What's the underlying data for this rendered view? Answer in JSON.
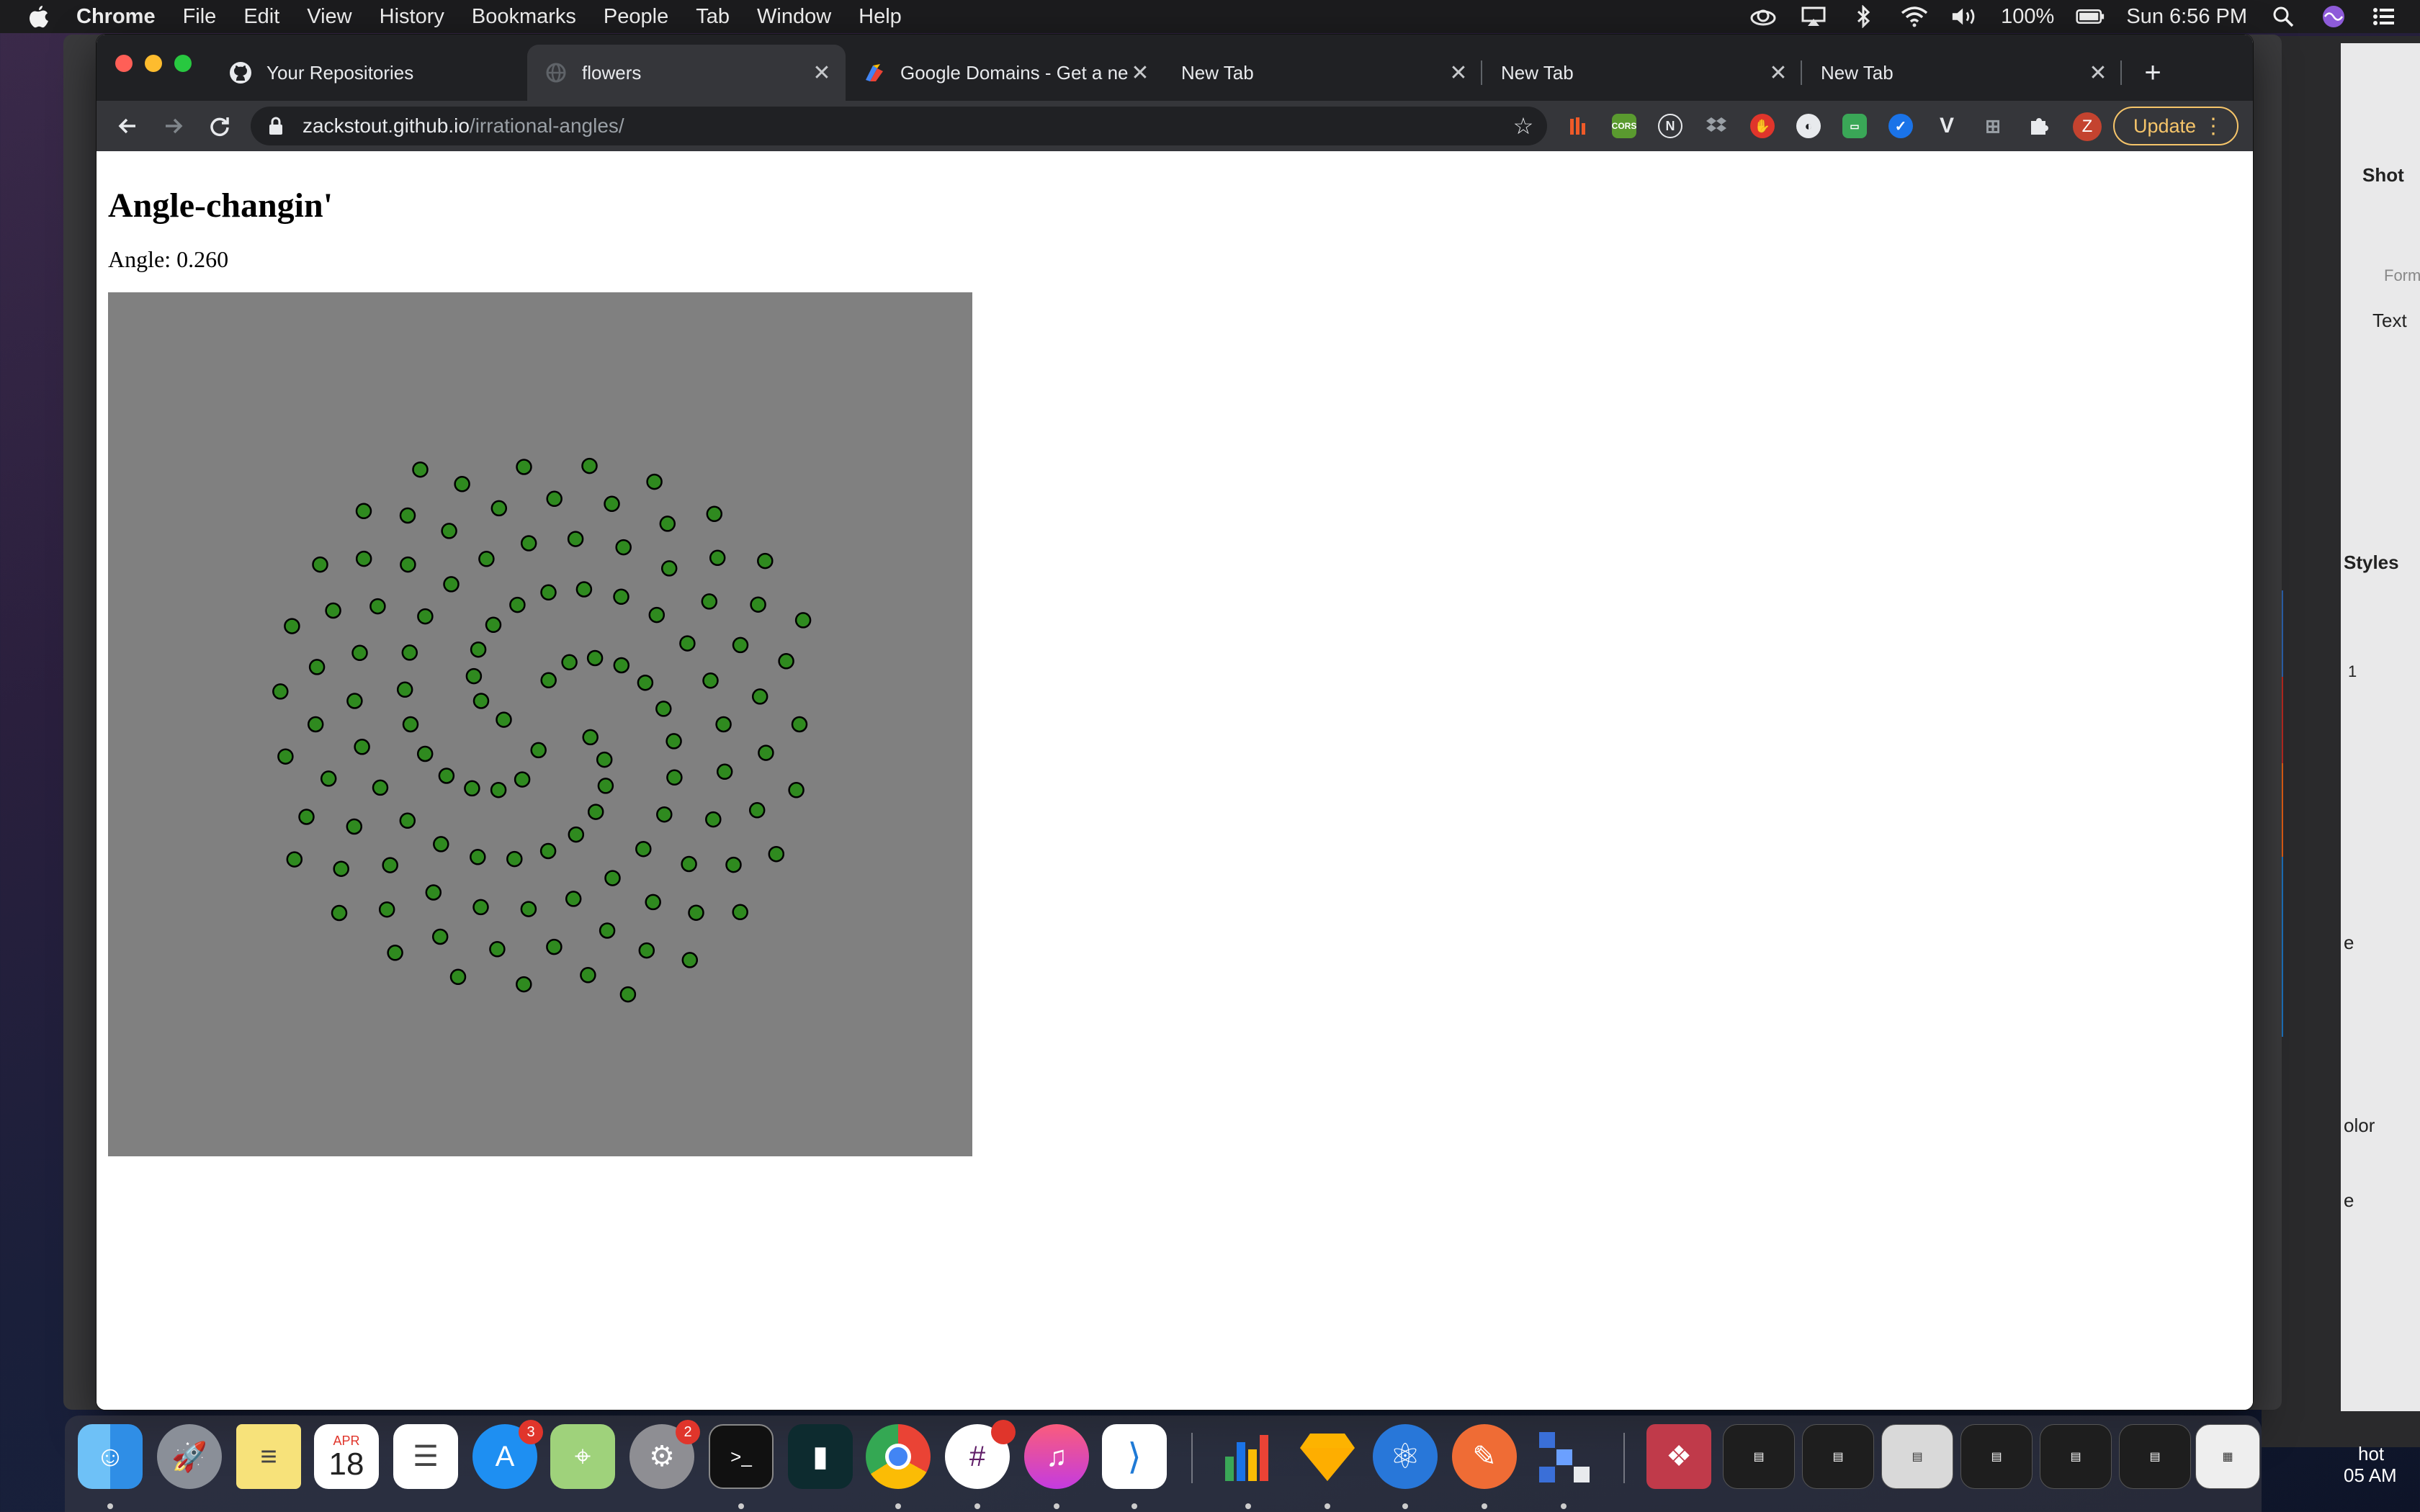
{
  "menubar": {
    "app": "Chrome",
    "items": [
      "File",
      "Edit",
      "View",
      "History",
      "Bookmarks",
      "People",
      "Tab",
      "Window",
      "Help"
    ],
    "battery": "100%",
    "clock": "Sun 6:56 PM"
  },
  "tabs": [
    {
      "title": "Your Repositories",
      "icon": "github-icon",
      "active": false
    },
    {
      "title": "flowers",
      "icon": "globe-icon",
      "active": true
    },
    {
      "title": "Google Domains - Get a new",
      "icon": "google-domains-icon",
      "active": false
    },
    {
      "title": "New Tab",
      "icon": "",
      "active": false
    },
    {
      "title": "New Tab",
      "icon": "",
      "active": false
    },
    {
      "title": "New Tab",
      "icon": "",
      "active": false
    }
  ],
  "address": {
    "host": "zackstout.github.io",
    "path": "/irrational-angles/"
  },
  "profile_initial": "Z",
  "update_label": "Update",
  "page": {
    "title": "Angle-changin'",
    "angle_label": "Angle: 0.260",
    "dot_count": 120,
    "angle_value": 0.26,
    "dot_color": "#2f8a1f",
    "canvas_color": "#808080"
  },
  "background_panel": {
    "labels": [
      "Shot",
      "Form",
      "Text",
      "Styles",
      "olor",
      "e",
      "e",
      "hot",
      "05 AM"
    ],
    "stepper_value": "1"
  },
  "dock": {
    "calendar_month": "APR",
    "calendar_day": "18",
    "appstore_badge": "3",
    "settings_badge": "2"
  }
}
